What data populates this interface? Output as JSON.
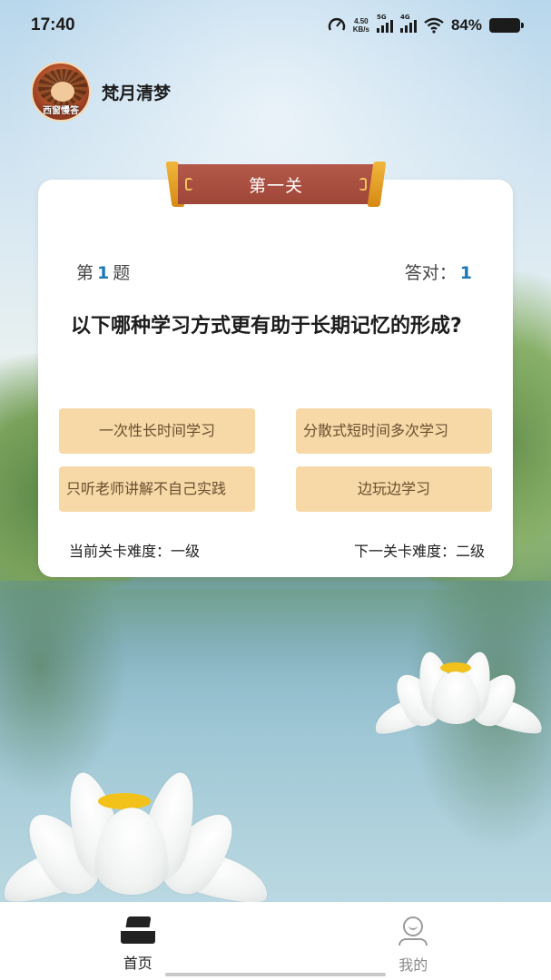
{
  "status_bar": {
    "time": "17:40",
    "net_speed_value": "4.50",
    "net_speed_unit": "KB/s",
    "signal1_label": "5G",
    "signal2_label": "4G",
    "battery": "84%"
  },
  "profile": {
    "username": "梵月清梦",
    "avatar_caption": "西窗慢答"
  },
  "level": {
    "title": "第一关"
  },
  "question": {
    "prefix": "第",
    "number": "1",
    "suffix": "题",
    "correct_label": "答对：",
    "correct_count": "1",
    "text": "以下哪种学习方式更有助于长期记忆的形成?"
  },
  "options": [
    "一次性长时间学习",
    "分散式短时间多次学习",
    "只听老师讲解不自己实践",
    "边玩边学习"
  ],
  "difficulty": {
    "current": "当前关卡难度：一级",
    "next": "下一关卡难度：二级"
  },
  "nav": {
    "home": "首页",
    "mine": "我的"
  },
  "colors": {
    "banner": "#a84e40",
    "option_bg": "#f7d9a8",
    "option_text": "#6a4e2e",
    "accent_number": "#1e78b4"
  }
}
